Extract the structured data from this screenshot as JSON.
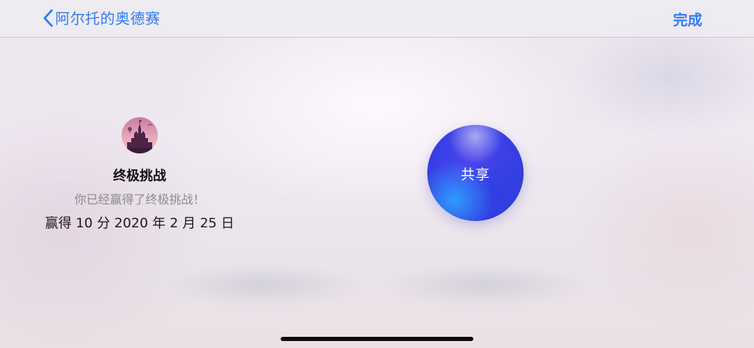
{
  "nav": {
    "back_label": "阿尔托的奥德赛",
    "done_label": "完成"
  },
  "achievement": {
    "badge_icon": "castle-badge-icon",
    "title": "终极挑战",
    "description": "你已经赢得了终极挑战！",
    "meta": "赢得 10 分 2020 年 2 月 25 日"
  },
  "share": {
    "label": "共享"
  },
  "colors": {
    "accent": "#2f7cf6",
    "share_button": "#3a3fe6"
  }
}
